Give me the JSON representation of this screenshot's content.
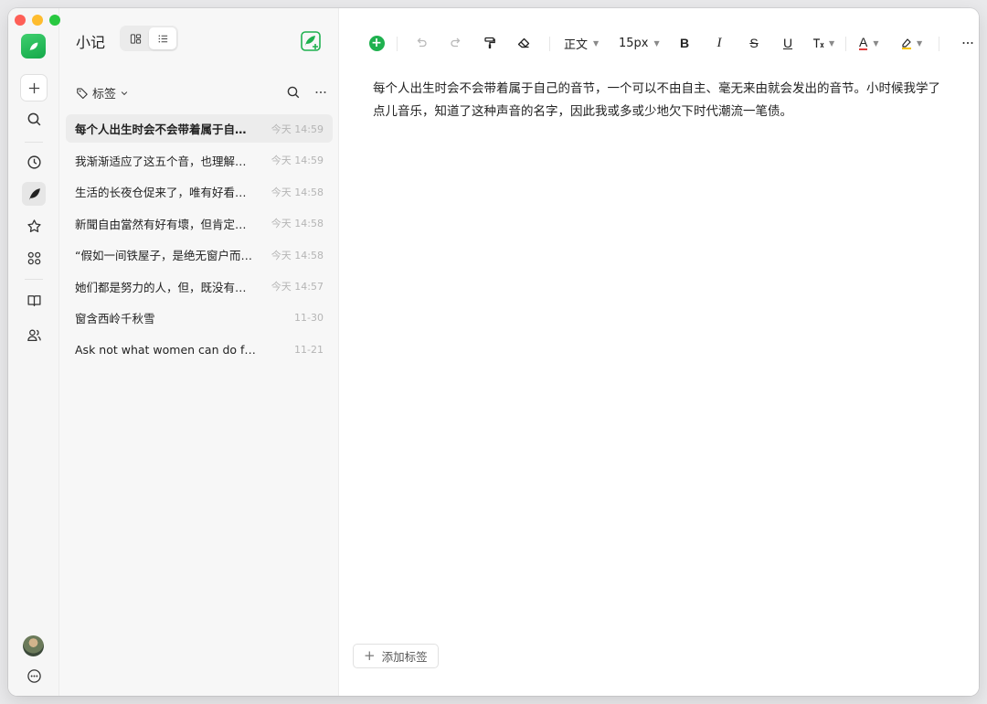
{
  "app": {
    "title": "小记"
  },
  "sidebar": {
    "icons": [
      "app-logo-icon",
      "add-icon",
      "search-icon",
      "clock-icon",
      "feather-icon",
      "star-icon",
      "apps-icon",
      "book-icon",
      "users-icon",
      "avatar",
      "more-circle-icon"
    ]
  },
  "list": {
    "filter_label": "标签",
    "notes": [
      {
        "title": "每个人出生时会不会带着属于自…",
        "time": "今天 14:59"
      },
      {
        "title": "我渐渐适应了这五个音，也理解…",
        "time": "今天 14:59"
      },
      {
        "title": "生活的长夜仓促来了，唯有好看…",
        "time": "今天 14:58"
      },
      {
        "title": "新聞自由當然有好有壞，但肯定…",
        "time": "今天 14:58"
      },
      {
        "title": "“假如一间铁屋子，是绝无窗户而…",
        "time": "今天 14:58"
      },
      {
        "title": "她们都是努力的人，但，既没有…",
        "time": "今天 14:57"
      },
      {
        "title": "窗含西岭千秋雪",
        "time": "11-30"
      },
      {
        "title": "Ask not what women can do for yo…",
        "time": "11-21"
      }
    ]
  },
  "toolbar": {
    "text_style": "正文",
    "font_size": "15px",
    "bold": "B",
    "italic": "I",
    "strike": "S",
    "underline": "U",
    "font_color": "A"
  },
  "editor": {
    "content": "每个人出生时会不会带着属于自己的音节，一个可以不由自主、毫无来由就会发出的音节。小时候我学了点儿音乐，知道了这种声音的名字，因此我或多或少地欠下时代潮流一笔债。",
    "add_tag_label": "添加标签"
  },
  "colors": {
    "accent": "#1fb14f",
    "selected_row": "#ececec"
  }
}
